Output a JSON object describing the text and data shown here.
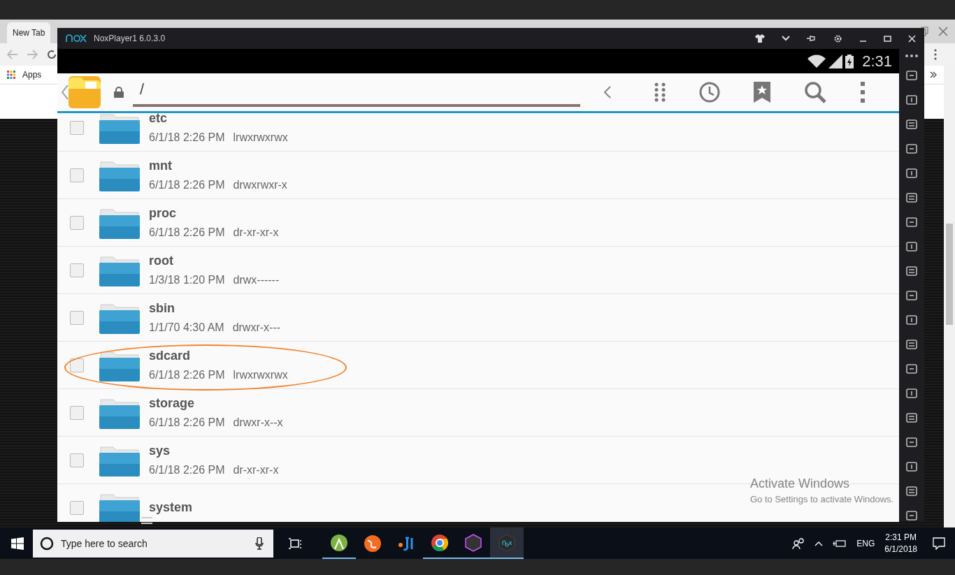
{
  "browser": {
    "tabs": [
      {
        "label": "New Tab",
        "selected": true
      }
    ],
    "bookmarks": [
      "Apps"
    ]
  },
  "emulator": {
    "title": "NoxPlayer1 6.0.3.0",
    "status_time": "2:31",
    "path": "/",
    "files": [
      {
        "name": "etc",
        "date": "6/1/18 2:26 PM",
        "permissions": "lrwxrwxrwx",
        "checked": false,
        "highlighted": false
      },
      {
        "name": "mnt",
        "date": "6/1/18 2:26 PM",
        "permissions": "drwxrwxr-x",
        "checked": false,
        "highlighted": false
      },
      {
        "name": "proc",
        "date": "6/1/18 2:26 PM",
        "permissions": "dr-xr-xr-x",
        "checked": false,
        "highlighted": false
      },
      {
        "name": "root",
        "date": "1/3/18 1:20 PM",
        "permissions": "drwx------",
        "checked": false,
        "highlighted": false
      },
      {
        "name": "sbin",
        "date": "1/1/70 4:30 AM",
        "permissions": "drwxr-x---",
        "checked": false,
        "highlighted": false
      },
      {
        "name": "sdcard",
        "date": "6/1/18 2:26 PM",
        "permissions": "lrwxrwxrwx",
        "checked": false,
        "highlighted": true
      },
      {
        "name": "storage",
        "date": "6/1/18 2:26 PM",
        "permissions": "drwxr-x--x",
        "checked": false,
        "highlighted": false
      },
      {
        "name": "sys",
        "date": "6/1/18 2:26 PM",
        "permissions": "dr-xr-xr-x",
        "checked": false,
        "highlighted": false
      },
      {
        "name": "system",
        "checked": false,
        "highlighted": false
      }
    ]
  },
  "activation_notice": {
    "title": "Activate Windows",
    "subtitle": "Go to Settings to activate Windows."
  },
  "taskbar": {
    "search_placeholder": "Type here to search",
    "language": "ENG",
    "time": "2:31 PM",
    "date": "6/1/2018"
  }
}
